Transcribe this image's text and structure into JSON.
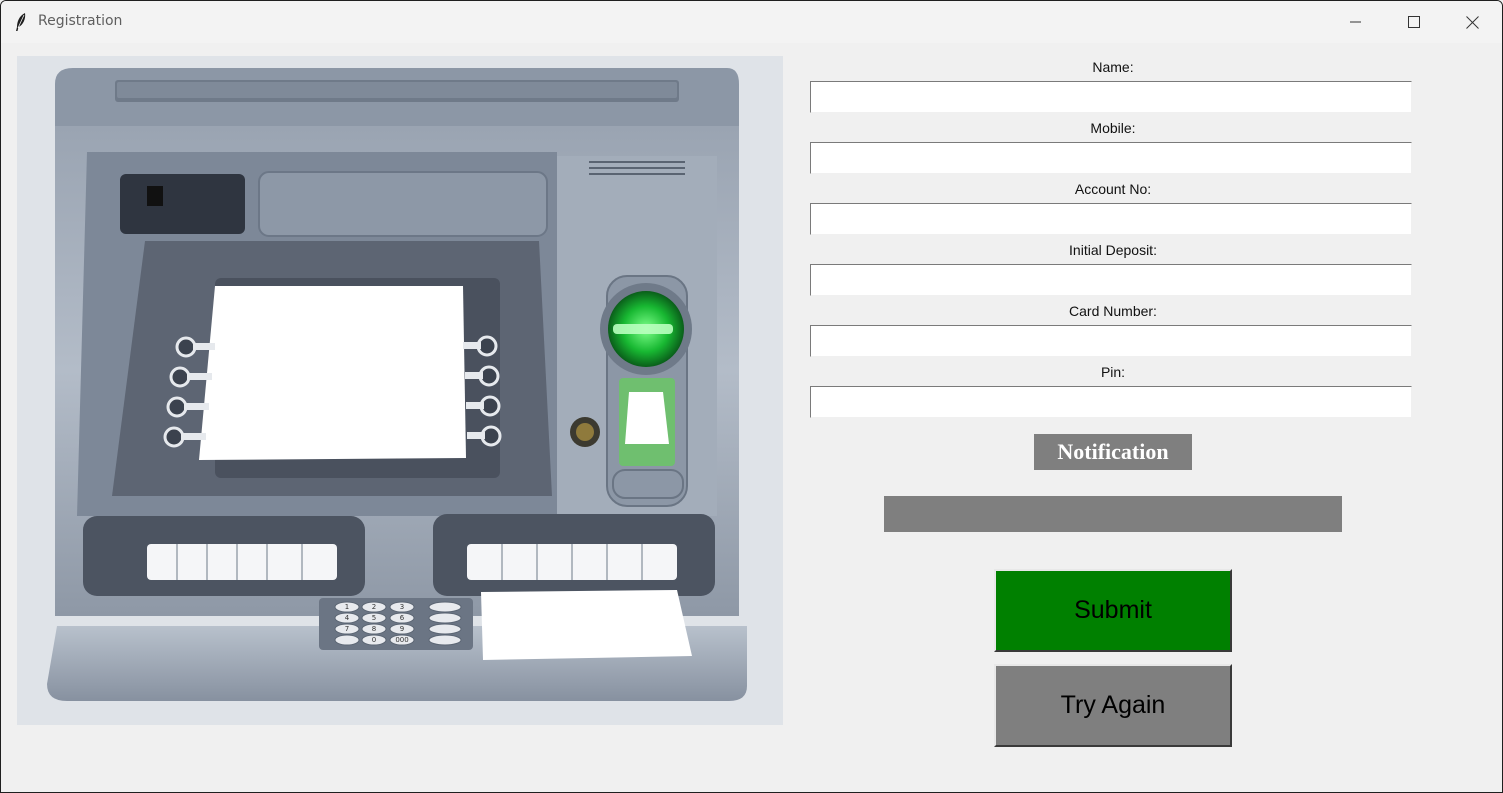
{
  "window": {
    "title": "Registration",
    "icon": "feather-icon",
    "controls": [
      "minimize-icon",
      "maximize-icon",
      "close-icon"
    ]
  },
  "form": {
    "fields": [
      {
        "label": "Name:",
        "value": ""
      },
      {
        "label": "Mobile:",
        "value": ""
      },
      {
        "label": "Account No:",
        "value": ""
      },
      {
        "label": "Initial Deposit:",
        "value": ""
      },
      {
        "label": "Card Number:",
        "value": ""
      },
      {
        "label": "Pin:",
        "value": ""
      }
    ],
    "notification_label": "Notification",
    "notification_text": "",
    "submit_label": "Submit",
    "try_again_label": "Try Again"
  },
  "atm_keypad": [
    "1",
    "2",
    "3",
    "4",
    "5",
    "6",
    "7",
    "8",
    "9",
    "0",
    "000"
  ],
  "colors": {
    "submit": "#008000",
    "try_again": "#7f7f7f",
    "notification": "#7f7f7f",
    "card_reader_light": "#2ecc40"
  }
}
